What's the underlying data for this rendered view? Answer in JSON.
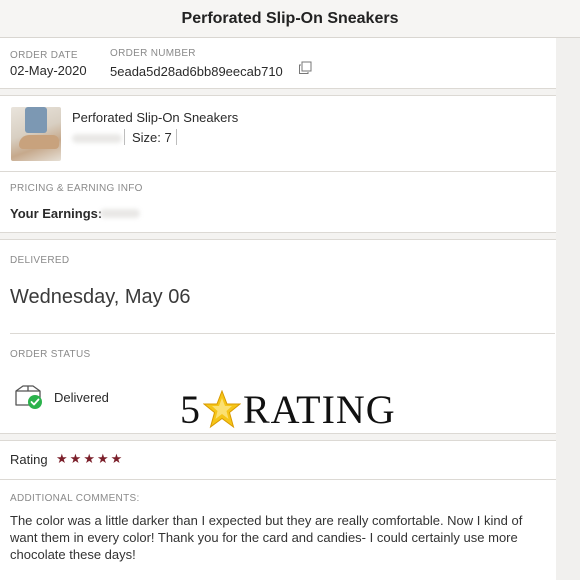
{
  "header": {
    "title": "Perforated Slip-On Sneakers"
  },
  "order": {
    "date_label": "ORDER DATE",
    "date": "02-May-2020",
    "number_label": "ORDER NUMBER",
    "number": "5eada5d28ad6bb89eecab710"
  },
  "item": {
    "name": "Perforated Slip-On Sneakers",
    "size": "Size: 7"
  },
  "pricing": {
    "section_label": "PRICING & EARNING INFO",
    "earnings_label": "Your Earnings:"
  },
  "delivery": {
    "section_label": "DELIVERED",
    "date": "Wednesday, May 06"
  },
  "status": {
    "section_label": "ORDER STATUS",
    "value": "Delivered"
  },
  "overlay": {
    "rating_number": "5",
    "rating_word": "RATING",
    "star_icon": "star-icon",
    "star_color": "#f5c518"
  },
  "rating": {
    "label": "Rating",
    "stars": 5,
    "star_color": "#7b1f2a"
  },
  "comments": {
    "section_label": "ADDITIONAL COMMENTS:",
    "text": "The color was a little darker than I expected but they are really comfortable. Now I kind of want them in every color! Thank you for the card and candies- I could certainly use more chocolate these days!"
  }
}
